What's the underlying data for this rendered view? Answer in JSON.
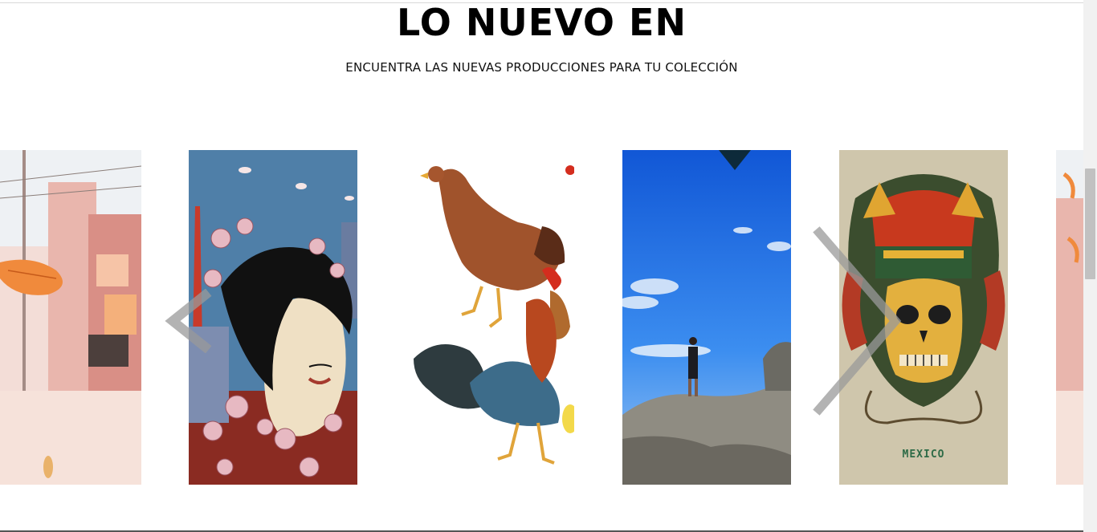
{
  "section": {
    "title": "LO NUEVO EN",
    "subtitle": "ENCUENTRA LAS NUEVAS PRODUCCIONES PARA TU COLECCIÓN"
  },
  "carousel": {
    "slides": [
      {
        "image": "autumn-street-illustration"
      },
      {
        "image": "woman-cherry-blossoms-tokyo-tower"
      },
      {
        "image": "hen-and-rooster-illustration"
      },
      {
        "image": "person-on-rock-blue-sky-photo"
      },
      {
        "image": "aztec-skull-mexico-illustration",
        "caption": "MEXICO"
      },
      {
        "image": "autumn-street-illustration"
      }
    ],
    "prev_icon": "chevron-left-icon",
    "next_icon": "chevron-right-icon"
  },
  "colors": {
    "sky_blue": "#1e6fe0",
    "beige": "#cfc6ac",
    "pale_blue": "#4f7fa8"
  }
}
